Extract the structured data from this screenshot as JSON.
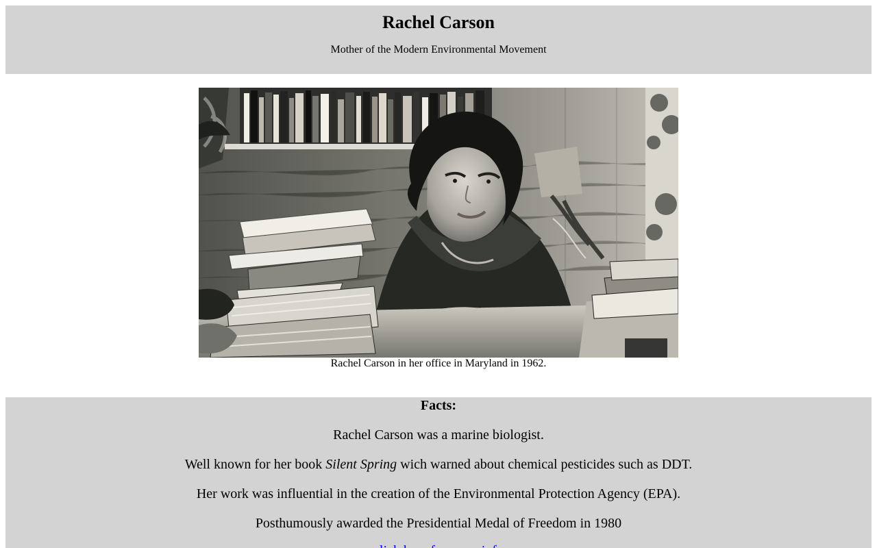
{
  "header": {
    "title": "Rachel Carson",
    "subtitle": "Mother of the Modern Environmental Movement"
  },
  "figure": {
    "caption": "Rachel Carson in her office in Maryland in 1962."
  },
  "facts": {
    "heading": "Facts:",
    "items": [
      {
        "text": "Rachel Carson was a marine biologist."
      },
      {
        "before": "Well known for her book ",
        "emphasis": "Silent Spring",
        "after": " wich warned about chemical pesticides such as DDT."
      },
      {
        "text": "Her work was influential in the creation of the Environmental Protection Agency (EPA)."
      },
      {
        "text": "Posthumously awarded the Presidential Medal of Freedom in 1980"
      }
    ],
    "link_label": "click here for more info"
  },
  "colors": {
    "panel_background": "#d3d3d3",
    "link": "#0000ee"
  }
}
